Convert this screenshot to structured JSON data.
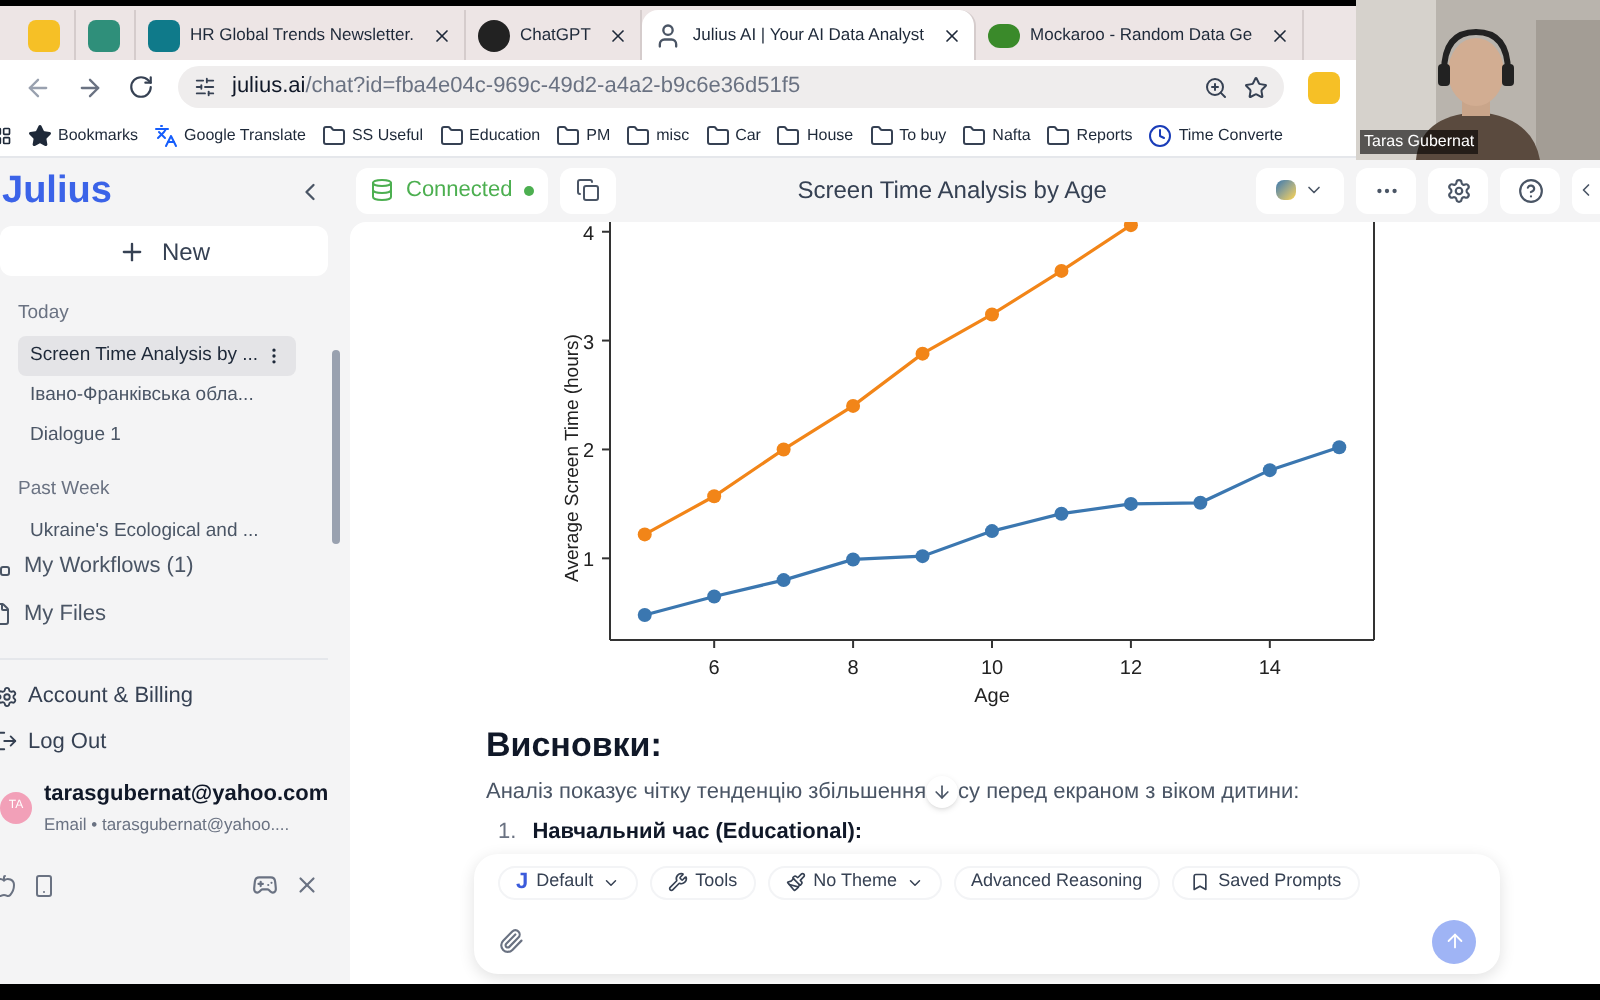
{
  "browser": {
    "tabs": [
      {
        "kind": "yellow",
        "selected": false
      },
      {
        "kind": "chart",
        "selected": false
      },
      {
        "kind": "sway",
        "label": "HR Global Trends Newsletter.",
        "selected": false
      },
      {
        "kind": "chatgpt",
        "label": "ChatGPT",
        "selected": false
      },
      {
        "kind": "julius",
        "label": "Julius AI | Your AI Data Analyst",
        "selected": true
      },
      {
        "kind": "leaf",
        "label": "Mockaroo - Random Data Ge",
        "selected": false
      }
    ],
    "url": {
      "host": "julius.ai",
      "path": "/chat?id=fba4e04c-969c-49d2-a4a2-b9c6e36d51f5"
    },
    "bookmarks": [
      {
        "kind": "star",
        "label": "Bookmarks"
      },
      {
        "kind": "translate",
        "label": "Google Translate"
      },
      {
        "kind": "folder",
        "label": "SS Useful"
      },
      {
        "kind": "folder",
        "label": "Education"
      },
      {
        "kind": "folder",
        "label": "PM"
      },
      {
        "kind": "folder",
        "label": "misc"
      },
      {
        "kind": "folder",
        "label": "Car"
      },
      {
        "kind": "folder",
        "label": "House"
      },
      {
        "kind": "folder",
        "label": "To buy"
      },
      {
        "kind": "folder",
        "label": "Nafta"
      },
      {
        "kind": "folder",
        "label": "Reports"
      },
      {
        "kind": "clock",
        "label": "Time Converte"
      }
    ]
  },
  "webcam": {
    "kind": "picture",
    "name": "Taras Gubernat"
  },
  "sidebar": {
    "logo": "Julius",
    "new_button": "New",
    "groups": [
      {
        "label": "Today",
        "items": [
          {
            "label": "Screen Time Analysis by ...",
            "selected": true
          },
          {
            "label": "Івано-Франківська обла...",
            "selected": false
          },
          {
            "label": "Dialogue 1",
            "selected": false
          }
        ]
      },
      {
        "label": "Past Week",
        "items": [
          {
            "label": "Ukraine's Ecological and ...",
            "selected": false
          }
        ]
      }
    ],
    "nav": [
      {
        "kind": "workflows",
        "label": "My Workflows (1)"
      },
      {
        "kind": "files",
        "label": "My Files"
      }
    ],
    "account": [
      {
        "kind": "gear",
        "label": "Account & Billing"
      },
      {
        "kind": "logout",
        "label": "Log Out"
      }
    ],
    "user": {
      "initials": "TA",
      "email": "tarasgubernat@yahoo.com",
      "detail": "Email • tarasgubernat@yahoo...."
    }
  },
  "header": {
    "status": "Connected",
    "title": "Screen Time Analysis by Age"
  },
  "chart_data": {
    "type": "line",
    "xlabel": "Age",
    "ylabel": "Average Screen Time (hours)",
    "x": [
      5,
      6,
      7,
      8,
      9,
      10,
      11,
      12,
      13,
      14,
      15
    ],
    "xlim": [
      4.5,
      15.5
    ],
    "ylim": [
      0.25,
      4.1
    ],
    "xticks": [
      6,
      8,
      10,
      12,
      14
    ],
    "yticks": [
      1,
      2,
      3,
      4
    ],
    "series": [
      {
        "color": "#f28518",
        "marker": "o",
        "values": [
          1.22,
          1.57,
          2.0,
          2.4,
          2.88,
          3.24,
          3.64,
          4.06,
          null,
          null,
          null
        ]
      },
      {
        "color": "#3b77b0",
        "marker": "o",
        "values": [
          0.48,
          0.65,
          0.8,
          0.99,
          1.02,
          1.25,
          1.41,
          1.5,
          1.51,
          1.81,
          2.02
        ]
      }
    ]
  },
  "answer": {
    "heading": "Висновки:",
    "paragraph_before": "Аналіз показує чітку тенденцію збільшення",
    "paragraph_after": "су перед екраном з віком дитини:",
    "list": [
      {
        "number": "1.",
        "text": "Навчальний час (Educational):"
      }
    ]
  },
  "composer": {
    "chips": [
      {
        "kind": "model",
        "badge": "J",
        "label": "Default",
        "dropdown": true
      },
      {
        "kind": "tools",
        "label": "Tools",
        "dropdown": false
      },
      {
        "kind": "theme",
        "label": "No Theme",
        "dropdown": true
      },
      {
        "kind": "plain",
        "label": "Advanced Reasoning",
        "dropdown": false
      },
      {
        "kind": "saved",
        "label": "Saved Prompts",
        "dropdown": false
      }
    ]
  }
}
